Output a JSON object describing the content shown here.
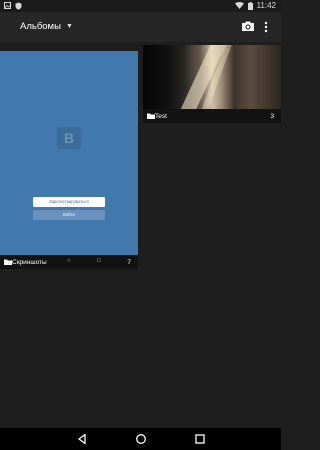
{
  "status_bar": {
    "time": "11:42"
  },
  "app_bar": {
    "title": "Альбомы"
  },
  "albums": [
    {
      "name": "Скриншоты",
      "count": "7",
      "thumbnail": {
        "logo_letter": "B",
        "register_label": "Зарегистрироваться",
        "login_label": "Войти"
      }
    },
    {
      "name": "Test",
      "count": "3"
    }
  ],
  "colors": {
    "background": "#1e1e1e",
    "app_bar": "#262626",
    "vk_blue": "#4179ad"
  },
  "icons": {
    "camera": "camera-icon",
    "overflow": "more-vert-icon",
    "folder": "folder-icon",
    "back": "back-icon",
    "home": "home-icon",
    "recents": "recents-icon"
  }
}
